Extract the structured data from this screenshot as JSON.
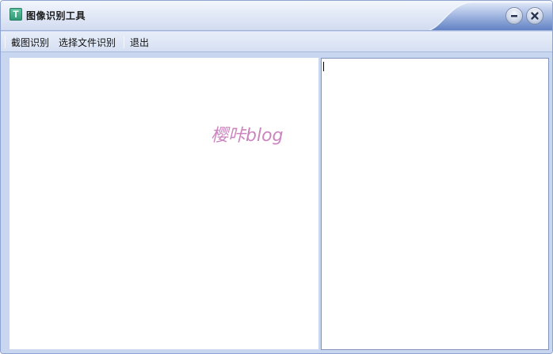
{
  "window": {
    "title": "图像识别工具",
    "icon_letter": "T",
    "icon": "app-icon",
    "controls": {
      "minimize_icon": "minimize-icon",
      "close_icon": "close-icon"
    }
  },
  "menu": {
    "items": [
      "截图识别",
      "选择文件识别",
      "退出"
    ]
  },
  "image_panel": {
    "watermark": "樱咔blog"
  },
  "result_panel": {
    "text": ""
  },
  "colors": {
    "frame": "#c9d6ef",
    "accent": "#4a6fb8",
    "watermark": "#c36fb2",
    "icon": "#2f9a76"
  }
}
